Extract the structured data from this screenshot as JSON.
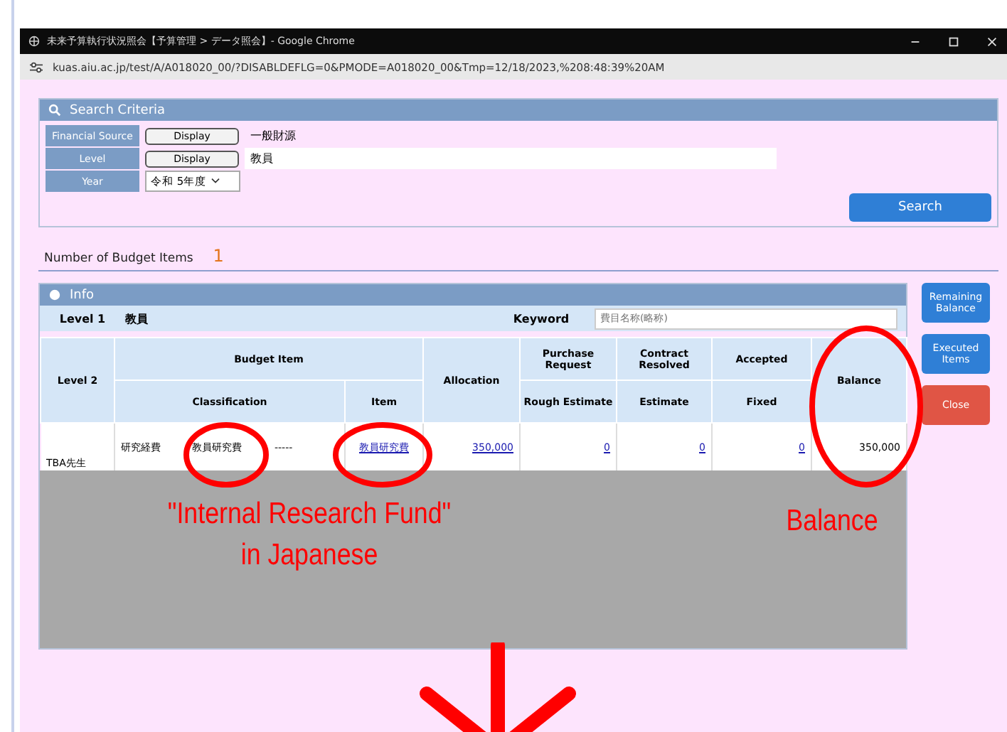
{
  "window": {
    "title": "未来予算執行状況照会【予算管理 > データ照会】- Google Chrome"
  },
  "address_bar": {
    "url": "kuas.aiu.ac.jp/test/A/A018020_00/?DISABLDEFLG=0&PMODE=A018020_00&Tmp=12/18/2023,%208:48:39%20AM"
  },
  "search_criteria": {
    "title": "Search Criteria",
    "rows": [
      {
        "label": "Financial Source",
        "kind": "display",
        "button": "Display",
        "value": "一般財源"
      },
      {
        "label": "Level",
        "kind": "display",
        "button": "Display",
        "value": "教員"
      },
      {
        "label": "Year",
        "kind": "select",
        "value": "令和 5年度"
      }
    ],
    "search_button": "Search"
  },
  "count": {
    "label": "Number of Budget Items",
    "value": "1"
  },
  "info": {
    "title": "Info",
    "level1_label": "Level 1",
    "level1_value": "教員",
    "keyword_label": "Keyword",
    "keyword_placeholder": "費目名称(略称)",
    "headers": {
      "level2": "Level 2",
      "budget_item": "Budget Item",
      "classification": "Classification",
      "item": "Item",
      "allocation": "Allocation",
      "purchase_request": "Purchase Request",
      "rough_estimate": "Rough Estimate",
      "contract_resolved": "Contract Resolved",
      "estimate": "Estimate",
      "accepted": "Accepted",
      "fixed": "Fixed",
      "balance": "Balance"
    },
    "rows": [
      {
        "level2": "TBA先生",
        "class_1": "研究経費",
        "class_2": "教員研究費",
        "class_3": "-----",
        "item": "教員研究費",
        "allocation": "350,000",
        "rough_estimate": "0",
        "estimate": "0",
        "fixed": "0",
        "balance": "350,000"
      }
    ]
  },
  "side_buttons": [
    {
      "label": "Remaining Balance",
      "kind": "blue"
    },
    {
      "label": "Executed Items",
      "kind": "blue"
    },
    {
      "label": "Close",
      "kind": "red"
    }
  ],
  "annotations": [
    {
      "text": "\"Internal Research Fund\" in Japanese"
    },
    {
      "text": "Balance"
    }
  ]
}
